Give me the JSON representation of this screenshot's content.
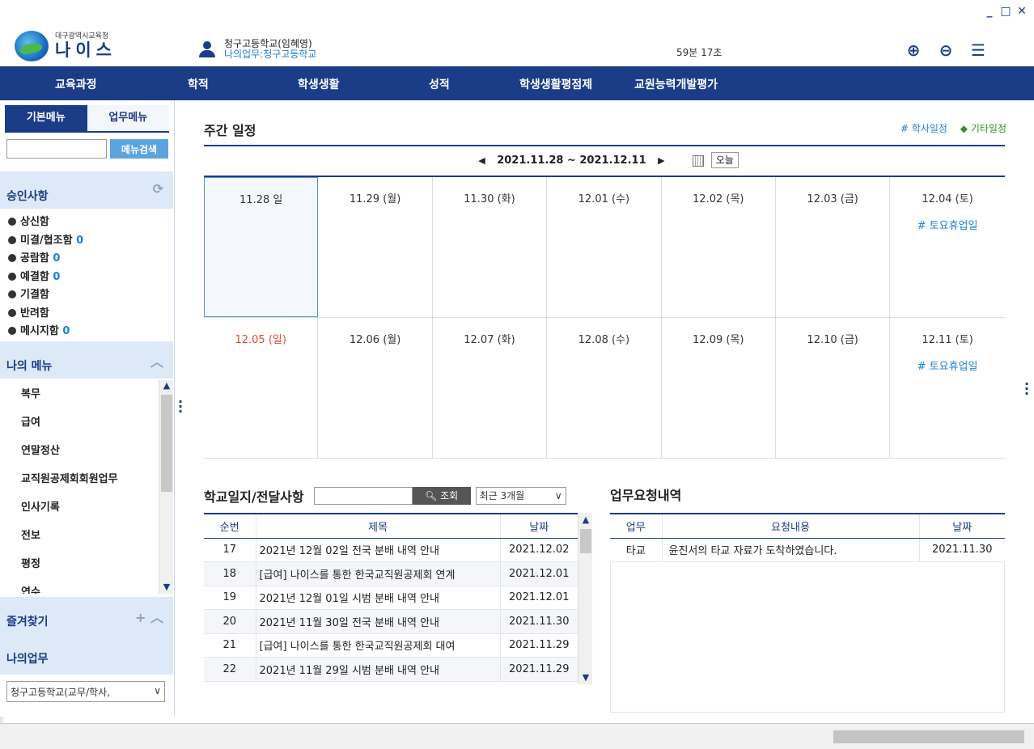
{
  "window_controls": [
    "_",
    "□",
    "✕"
  ],
  "logo": {
    "sub": "대구광역시교육청",
    "main": "나이스"
  },
  "user": {
    "name": "청구고등학교(임혜영)",
    "work": "나의업무:청구고등학교"
  },
  "timer": "59분 17초",
  "header_icons": [
    "zoom-in-icon",
    "zoom-out-icon",
    "hamburger-menu-icon"
  ],
  "nav": [
    "교육과정",
    "학적",
    "학생생활",
    "성적",
    "학생생활평점제",
    "교원능력개발평가"
  ],
  "sidebar": {
    "tabs": [
      "기본메뉴",
      "업무메뉴"
    ],
    "search_button": "메뉴검색",
    "approval": {
      "title": "승인사항",
      "items": [
        {
          "label": "상신함",
          "count": ""
        },
        {
          "label": "미결/협조함",
          "count": "0"
        },
        {
          "label": "공람함",
          "count": "0"
        },
        {
          "label": "예결함",
          "count": "0"
        },
        {
          "label": "기결함",
          "count": ""
        },
        {
          "label": "반려함",
          "count": ""
        },
        {
          "label": "메시지함",
          "count": "0"
        }
      ]
    },
    "mymenu": {
      "title": "나의 메뉴",
      "items": [
        "복무",
        "급여",
        "연말정산",
        "교직원공제회회원업무",
        "인사기록",
        "전보",
        "평정",
        "연수"
      ]
    },
    "favorites": "즐겨찾기",
    "myjob": {
      "title": "나의업무",
      "selected": "청구고등학교(교무/학사,"
    }
  },
  "weekly": {
    "title": "주간 일정",
    "legend": {
      "academic": "# 학사일정",
      "other": "◆ 기타일정"
    },
    "range": "2021.11.28 ~ 2021.12.11",
    "today": "오늘",
    "weeks": [
      [
        {
          "date": "11.28 일",
          "event": "",
          "sun": true,
          "selected": true
        },
        {
          "date": "11.29 (월)",
          "event": ""
        },
        {
          "date": "11.30 (화)",
          "event": ""
        },
        {
          "date": "12.01 (수)",
          "event": ""
        },
        {
          "date": "12.02 (목)",
          "event": ""
        },
        {
          "date": "12.03 (금)",
          "event": ""
        },
        {
          "date": "12.04 (토)",
          "event": "# 토요휴업일"
        }
      ],
      [
        {
          "date": "12.05 (일)",
          "event": "",
          "sun": true,
          "red": true
        },
        {
          "date": "12.06 (월)",
          "event": ""
        },
        {
          "date": "12.07 (화)",
          "event": ""
        },
        {
          "date": "12.08 (수)",
          "event": ""
        },
        {
          "date": "12.09 (목)",
          "event": ""
        },
        {
          "date": "12.10 (금)",
          "event": ""
        },
        {
          "date": "12.11 (토)",
          "event": "# 토요휴업일"
        }
      ]
    ]
  },
  "school_log": {
    "title": "학교일지/전달사항",
    "query_button": "조회",
    "period": "최근 3개월",
    "columns": [
      "순번",
      "제목",
      "날짜"
    ],
    "rows": [
      [
        "17",
        "2021년 12월 02일 전국 분배 내역 안내",
        "2021.12.02"
      ],
      [
        "18",
        "[급여] 나이스를 통한 한국교직원공제회 연계",
        "2021.12.01"
      ],
      [
        "19",
        "2021년 12월 01일 시범 분배 내역 안내",
        "2021.12.01"
      ],
      [
        "20",
        "2021년 11월 30일 전국 분배 내역 안내",
        "2021.11.30"
      ],
      [
        "21",
        "[급여] 나이스를 통한 한국교직원공제회 대여",
        "2021.11.29"
      ],
      [
        "22",
        "2021년 11월 29일 시범 분배 내역 안내",
        "2021.11.29"
      ]
    ]
  },
  "requests": {
    "title": "업무요청내역",
    "columns": [
      "업무",
      "요청내용",
      "날짜"
    ],
    "rows": [
      [
        "타교",
        "윤진서의 타교 자료가 도착하였습니다.",
        "2021.11.30"
      ]
    ]
  }
}
